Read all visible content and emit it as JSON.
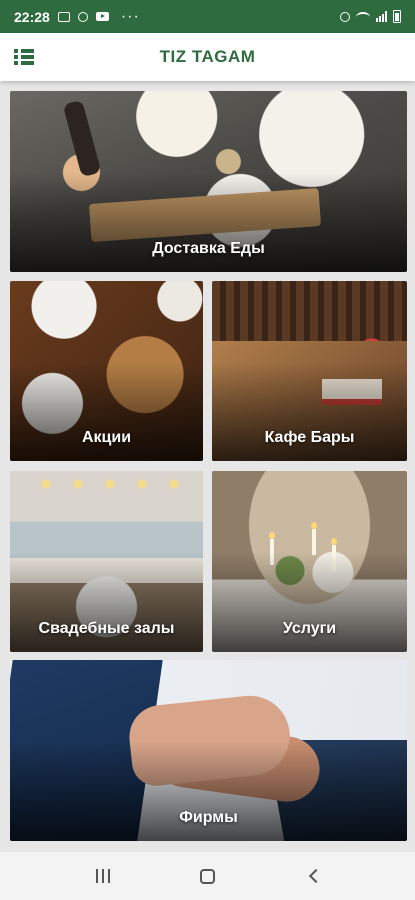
{
  "status_bar": {
    "time": "22:28",
    "more": "···"
  },
  "app_bar": {
    "title": "TIZ TAGAM"
  },
  "tiles": {
    "food_delivery": "Доставка Еды",
    "promotions": "Акции",
    "cafe_bars": "Кафе Бары",
    "wedding_halls": "Свадебные залы",
    "services": "Услуги",
    "firms": "Фирмы"
  },
  "colors": {
    "brand_green": "#2e6b3f",
    "background": "#e6e6e6"
  }
}
